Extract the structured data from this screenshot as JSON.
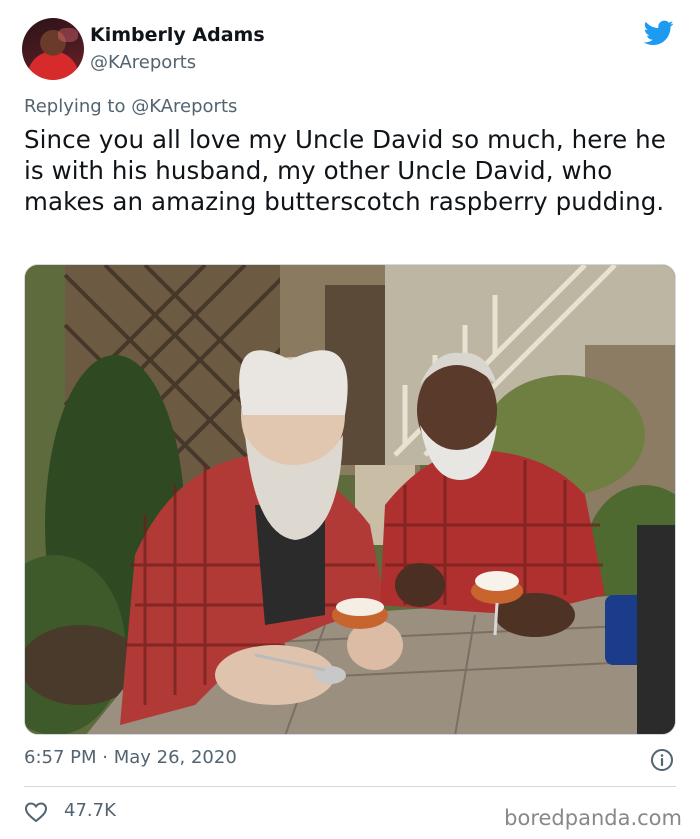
{
  "author": {
    "name": "Kimberly Adams",
    "handle": "@KAreports"
  },
  "reply": {
    "prefix": "Replying to",
    "mention": "@KAreports"
  },
  "tweet": {
    "text": "Since you all love my Uncle David so much, here he is with his husband, my other Uncle David, who makes an amazing butterscotch raspberry pudding."
  },
  "meta": {
    "timestamp": "6:57 PM · May 26, 2020"
  },
  "stats": {
    "likes": "47.7K"
  },
  "watermark": "boredpanda.com",
  "colors": {
    "twitter_blue": "#1d9bf0",
    "secondary_text": "#536471",
    "primary_text": "#0f1419"
  },
  "icons": [
    "twitter-bird-icon",
    "info-icon",
    "heart-icon"
  ]
}
